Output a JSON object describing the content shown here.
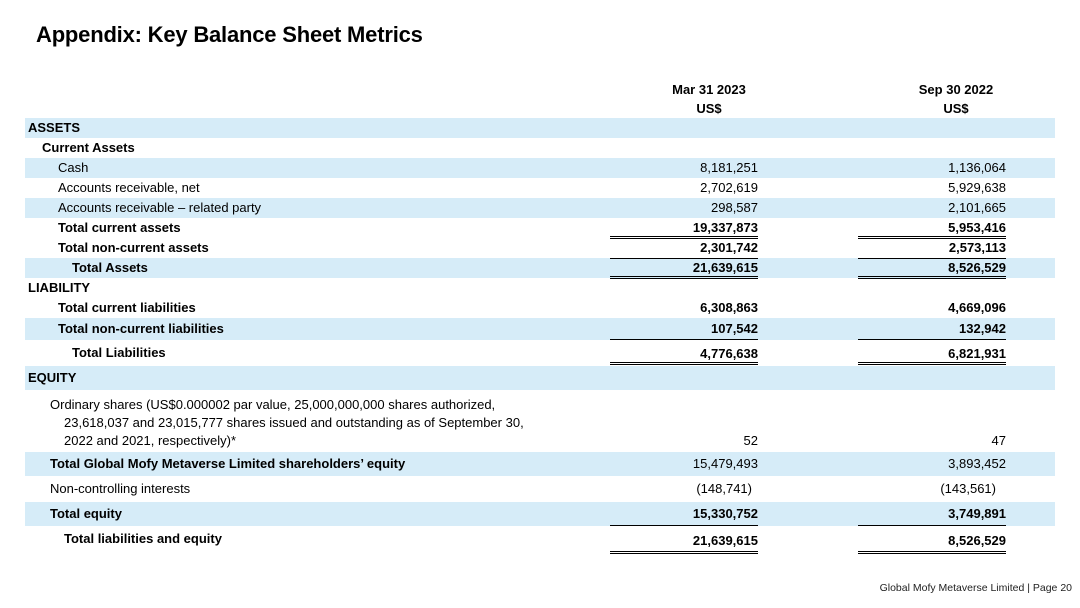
{
  "title": "Appendix: Key Balance Sheet Metrics",
  "columns": [
    {
      "date": "Mar 31 2023",
      "unit": "US$"
    },
    {
      "date": "Sep 30 2022",
      "unit": "US$"
    }
  ],
  "rows": {
    "assets": {
      "label": "ASSETS"
    },
    "current_assets": {
      "label": "Current Assets"
    },
    "cash": {
      "label": "Cash",
      "v1": "8,181,251",
      "v2": "1,136,064"
    },
    "ar_net": {
      "label": "Accounts receivable, net",
      "v1": "2,702,619",
      "v2": "5,929,638"
    },
    "ar_related": {
      "label": "Accounts receivable – related party",
      "v1": "298,587",
      "v2": "2,101,665"
    },
    "total_current_assets": {
      "label": "Total current assets",
      "v1": "19,337,873",
      "v2": "5,953,416"
    },
    "total_noncurrent_assets": {
      "label": "Total non-current assets",
      "v1": "2,301,742",
      "v2": "2,573,113"
    },
    "total_assets": {
      "label": "Total Assets",
      "v1": "21,639,615",
      "v2": "8,526,529"
    },
    "liability": {
      "label": "LIABILITY"
    },
    "total_current_liabilities": {
      "label": "Total current liabilities",
      "v1": "6,308,863",
      "v2": "4,669,096"
    },
    "total_noncurrent_liabilities": {
      "label": "Total non-current liabilities",
      "v1": "107,542",
      "v2": "132,942"
    },
    "total_liabilities": {
      "label": "Total Liabilities",
      "v1": "4,776,638",
      "v2": "6,821,931"
    },
    "equity": {
      "label": "EQUITY"
    },
    "ordinary_shares": {
      "label_lines": [
        "Ordinary shares (US$0.000002 par value, 25,000,000,000 shares authorized,",
        "23,618,037 and 23,015,777 shares issued and outstanding as of September 30,",
        "2022 and 2021, respectively)*"
      ],
      "v1": "52",
      "v2": "47"
    },
    "shareholders_equity": {
      "label": "Total Global Mofy Metaverse Limited shareholders’ equity",
      "v1": "15,479,493",
      "v2": "3,893,452"
    },
    "noncontrolling": {
      "label": "Non-controlling interests",
      "v1": "(148,741)",
      "v2": "(143,561)"
    },
    "total_equity": {
      "label": "Total equity",
      "v1": "15,330,752",
      "v2": "3,749,891"
    },
    "total_liabilities_equity": {
      "label": "Total liabilities and equity",
      "v1": "21,639,615",
      "v2": "8,526,529"
    }
  },
  "footer": "Global Mofy Metaverse Limited | Page 20",
  "colors": {
    "row_shade": "#d6ecf8"
  }
}
